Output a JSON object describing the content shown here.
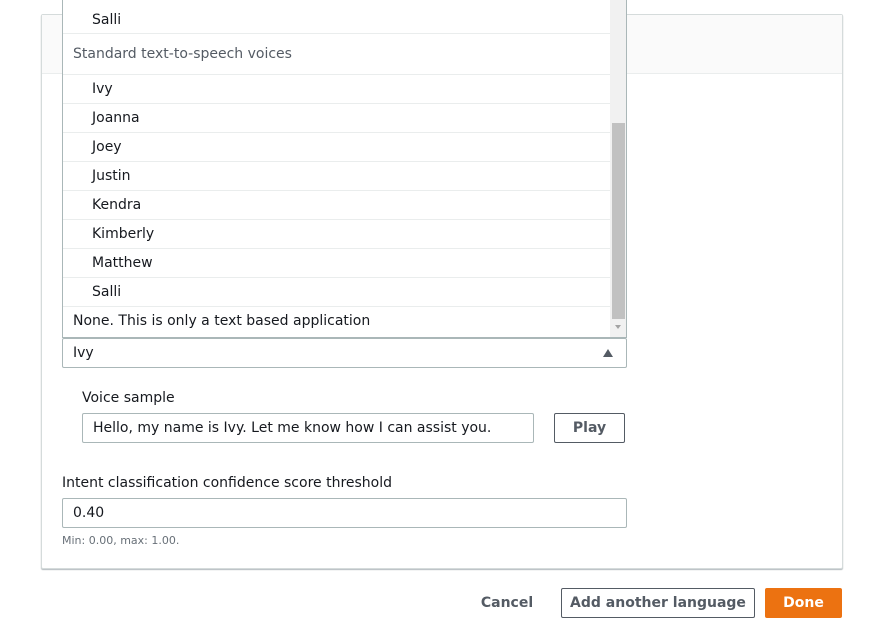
{
  "dropdown": {
    "neural_tail": "Salli",
    "group_label": "Standard text-to-speech voices",
    "standard_options": [
      "Ivy",
      "Joanna",
      "Joey",
      "Justin",
      "Kendra",
      "Kimberly",
      "Matthew",
      "Salli"
    ],
    "none_option": "None. This is only a text based application"
  },
  "voice_select": {
    "value": "Ivy"
  },
  "voice_sample": {
    "label": "Voice sample",
    "value": "Hello, my name is Ivy. Let me know how I can assist you.",
    "play_label": "Play"
  },
  "confidence": {
    "label": "Intent classification confidence score threshold",
    "value": "0.40",
    "hint": "Min: 0.00, max: 1.00."
  },
  "footer": {
    "cancel_label": "Cancel",
    "add_language_label": "Add another language",
    "done_label": "Done"
  },
  "colors": {
    "primary": "#ec7211",
    "border": "#aab7b8",
    "text": "#16191f"
  }
}
